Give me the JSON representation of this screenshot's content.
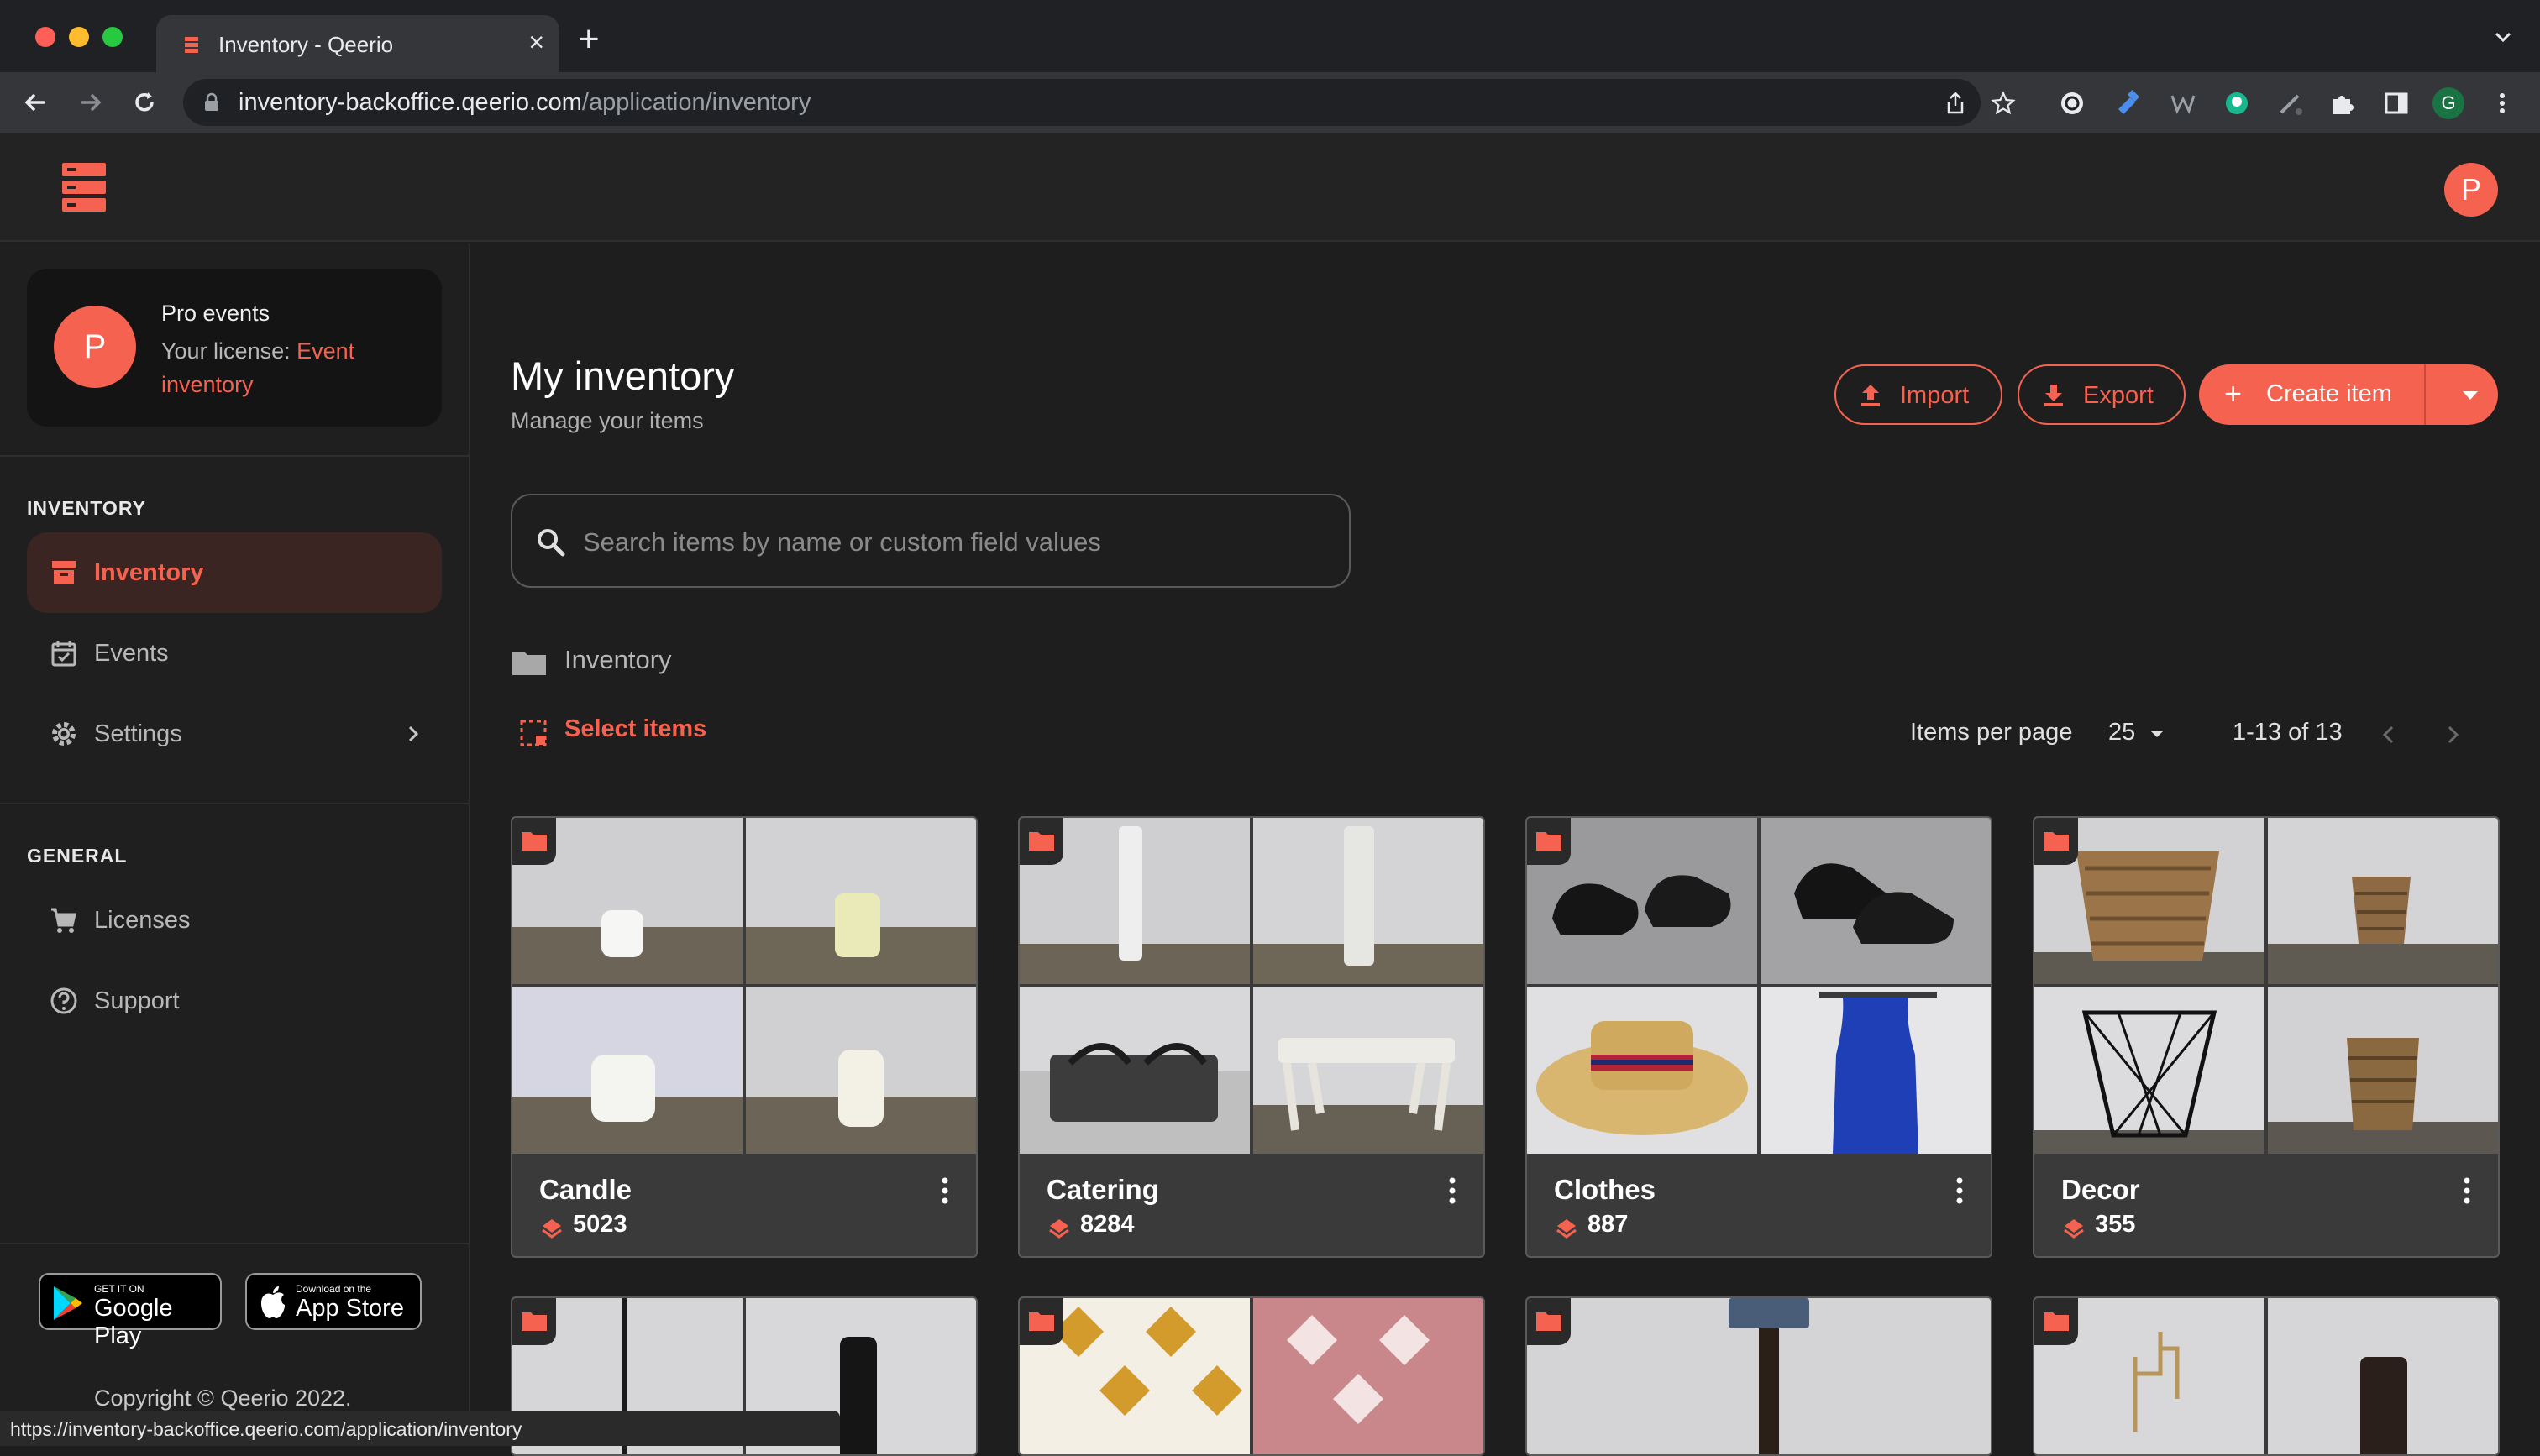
{
  "browser": {
    "tab_title": "Inventory - Qeerio",
    "url_host": "inventory-backoffice.qeerio.com",
    "url_path": "/application/inventory",
    "status_url": "https://inventory-backoffice.qeerio.com/application/inventory",
    "profile_initial": "G"
  },
  "app": {
    "user_initial": "P",
    "accent": "#f5624f"
  },
  "sidebar": {
    "org": {
      "initial": "P",
      "name": "Pro events",
      "license_prefix": "Your license:",
      "license_name": "Event inventory"
    },
    "sections": [
      {
        "label": "INVENTORY",
        "items": [
          {
            "label": "Inventory",
            "icon": "archive-icon",
            "active": true
          },
          {
            "label": "Events",
            "icon": "calendar-check-icon",
            "active": false
          },
          {
            "label": "Settings",
            "icon": "gear-icon",
            "active": false
          }
        ]
      },
      {
        "label": "GENERAL",
        "items": [
          {
            "label": "Licenses",
            "icon": "cart-icon",
            "active": false
          },
          {
            "label": "Support",
            "icon": "help-circle-icon",
            "active": false
          }
        ]
      }
    ],
    "badges": {
      "google_small": "GET IT ON",
      "google_big": "Google Play",
      "apple_small": "Download on the",
      "apple_big": "App Store"
    },
    "copyright": "Copyright © Qeerio 2022."
  },
  "main": {
    "title": "My inventory",
    "subtitle": "Manage your items",
    "buttons": {
      "import": "Import",
      "export": "Export",
      "create": "Create item"
    },
    "search_placeholder": "Search items by name or custom field values",
    "breadcrumb": "Inventory",
    "select_items": "Select items",
    "pager": {
      "items_per_page_label": "Items per page",
      "items_per_page_value": "25",
      "range": "1-13 of 13"
    },
    "categories": [
      {
        "name": "Candle",
        "count": "5023"
      },
      {
        "name": "Catering",
        "count": "8284"
      },
      {
        "name": "Clothes",
        "count": "887"
      },
      {
        "name": "Decor",
        "count": "355"
      }
    ]
  }
}
